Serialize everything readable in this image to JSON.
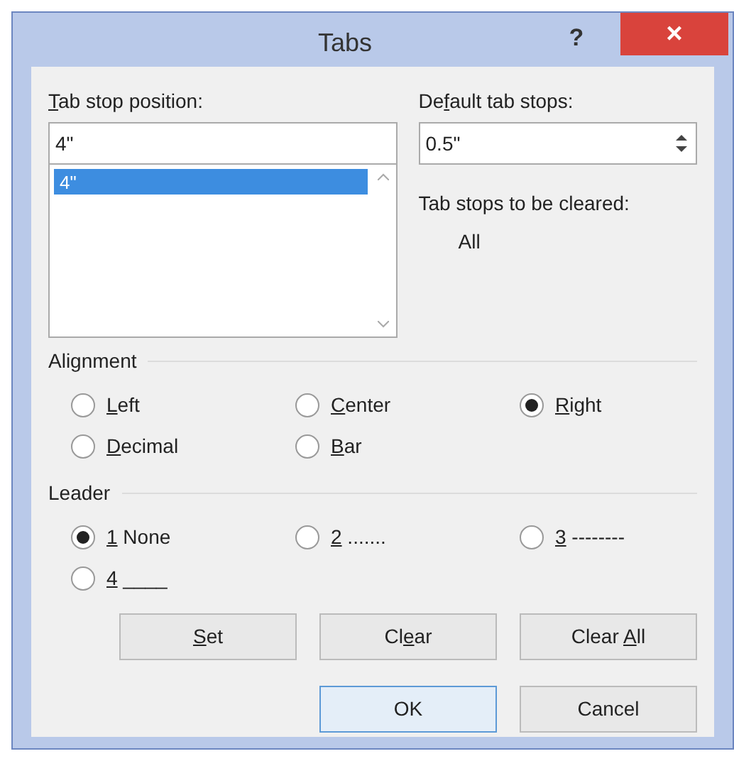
{
  "window": {
    "title": "Tabs",
    "help": "?",
    "close": "×"
  },
  "tab_stop_position": {
    "label": {
      "key": "T",
      "post": "ab stop position:"
    },
    "value": "4\"",
    "list": [
      {
        "text": "4\"",
        "selected": true
      }
    ]
  },
  "default_tab_stops": {
    "label": {
      "pre": "De",
      "key": "f",
      "post": "ault tab stops:"
    },
    "value": "0.5\""
  },
  "to_be_cleared": {
    "label": "Tab stops to be cleared:",
    "value": "All"
  },
  "alignment": {
    "title": "Alignment",
    "options": [
      {
        "label": {
          "key": "L",
          "post": "eft"
        },
        "selected": false
      },
      {
        "label": {
          "key": "C",
          "post": "enter"
        },
        "selected": false
      },
      {
        "label": {
          "key": "R",
          "post": "ight"
        },
        "selected": true
      },
      {
        "label": {
          "key": "D",
          "post": "ecimal"
        },
        "selected": false
      },
      {
        "label": {
          "key": "B",
          "post": "ar"
        },
        "selected": false
      }
    ]
  },
  "leader": {
    "title": "Leader",
    "options": [
      {
        "label": {
          "key": "1",
          "post": " None"
        },
        "selected": true
      },
      {
        "label": {
          "key": "2",
          "post": " ......."
        },
        "selected": false
      },
      {
        "label": {
          "key": "3",
          "post": " --------"
        },
        "selected": false
      },
      {
        "label": {
          "key": "4",
          "post": " ____"
        },
        "selected": false
      }
    ]
  },
  "action_buttons": [
    {
      "label": {
        "key": "S",
        "post": "et"
      }
    },
    {
      "label": {
        "pre": "Cl",
        "key": "e",
        "post": "ar"
      }
    },
    {
      "label": {
        "pre": "Clear ",
        "key": "A",
        "post": "ll"
      }
    }
  ],
  "dialog_buttons": [
    {
      "label": "OK",
      "default": true
    },
    {
      "label": "Cancel",
      "default": false
    }
  ]
}
